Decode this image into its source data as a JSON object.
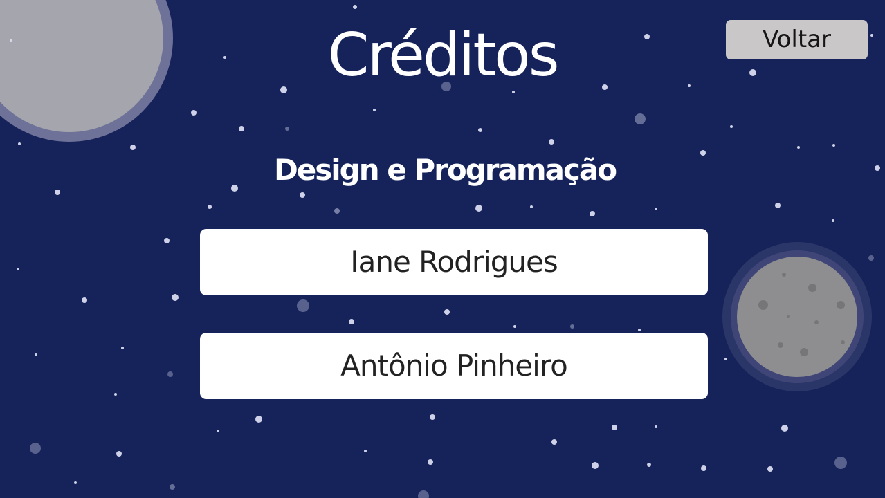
{
  "screen": {
    "title": "Créditos",
    "back_button_label": "Voltar",
    "section_title": "Design e Programação",
    "credits": [
      {
        "name": "Iane Rodrigues"
      },
      {
        "name": "Antônio Pinheiro"
      }
    ]
  },
  "colors": {
    "background": "#16235a",
    "star": "#d7d9ec",
    "planet_large": "#a6a6ae",
    "planet_large_ring": "#707396",
    "moon": "#8f8f91",
    "moon_crater": "#7a7a7c",
    "moon_halo": "#3a4273",
    "button_bg": "#c9c7c7",
    "card_bg": "#ffffff"
  },
  "icons": {
    "planet": "planet-icon",
    "moon": "moon-icon",
    "stars": "starfield"
  }
}
